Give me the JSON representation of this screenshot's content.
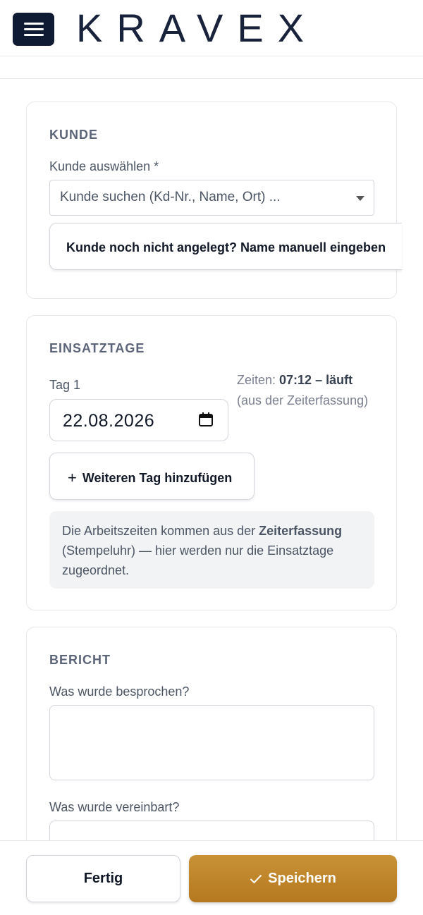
{
  "header": {
    "brand": "KRAVEX"
  },
  "customer": {
    "title": "KUNDE",
    "select_label": "Kunde auswählen *",
    "select_placeholder": "Kunde suchen (Kd-Nr., Name, Ort) ...",
    "manual_button": "Kunde noch nicht angelegt? Name manuell eingeben"
  },
  "days": {
    "title": "EINSATZTAGE",
    "day_label": "Tag 1",
    "date_value": "22.08.2026",
    "times_prefix": "Zeiten: ",
    "times_value": "07:12 – läuft",
    "times_suffix": " (aus der Zeiterfassung)",
    "add_button": "Weiteren Tag hinzufügen",
    "info_pre": "Die Arbeitszeiten kommen aus der ",
    "info_bold": "Zeiterfassung",
    "info_post": " (Stempeluhr) — hier werden nur die Einsatztage zugeordnet."
  },
  "report": {
    "title": "BERICHT",
    "q1_label": "Was wurde besprochen?",
    "q1_value": "",
    "q2_label": "Was wurde vereinbart?",
    "q2_value": ""
  },
  "footer": {
    "done_label": "Fertig",
    "save_label": "Speichern"
  },
  "colors": {
    "header_button_bg": "#0f1b33",
    "logo_dark": "#18223a",
    "logo_accent": "#2f5bd8",
    "save_button_bg": "#b97f25"
  }
}
